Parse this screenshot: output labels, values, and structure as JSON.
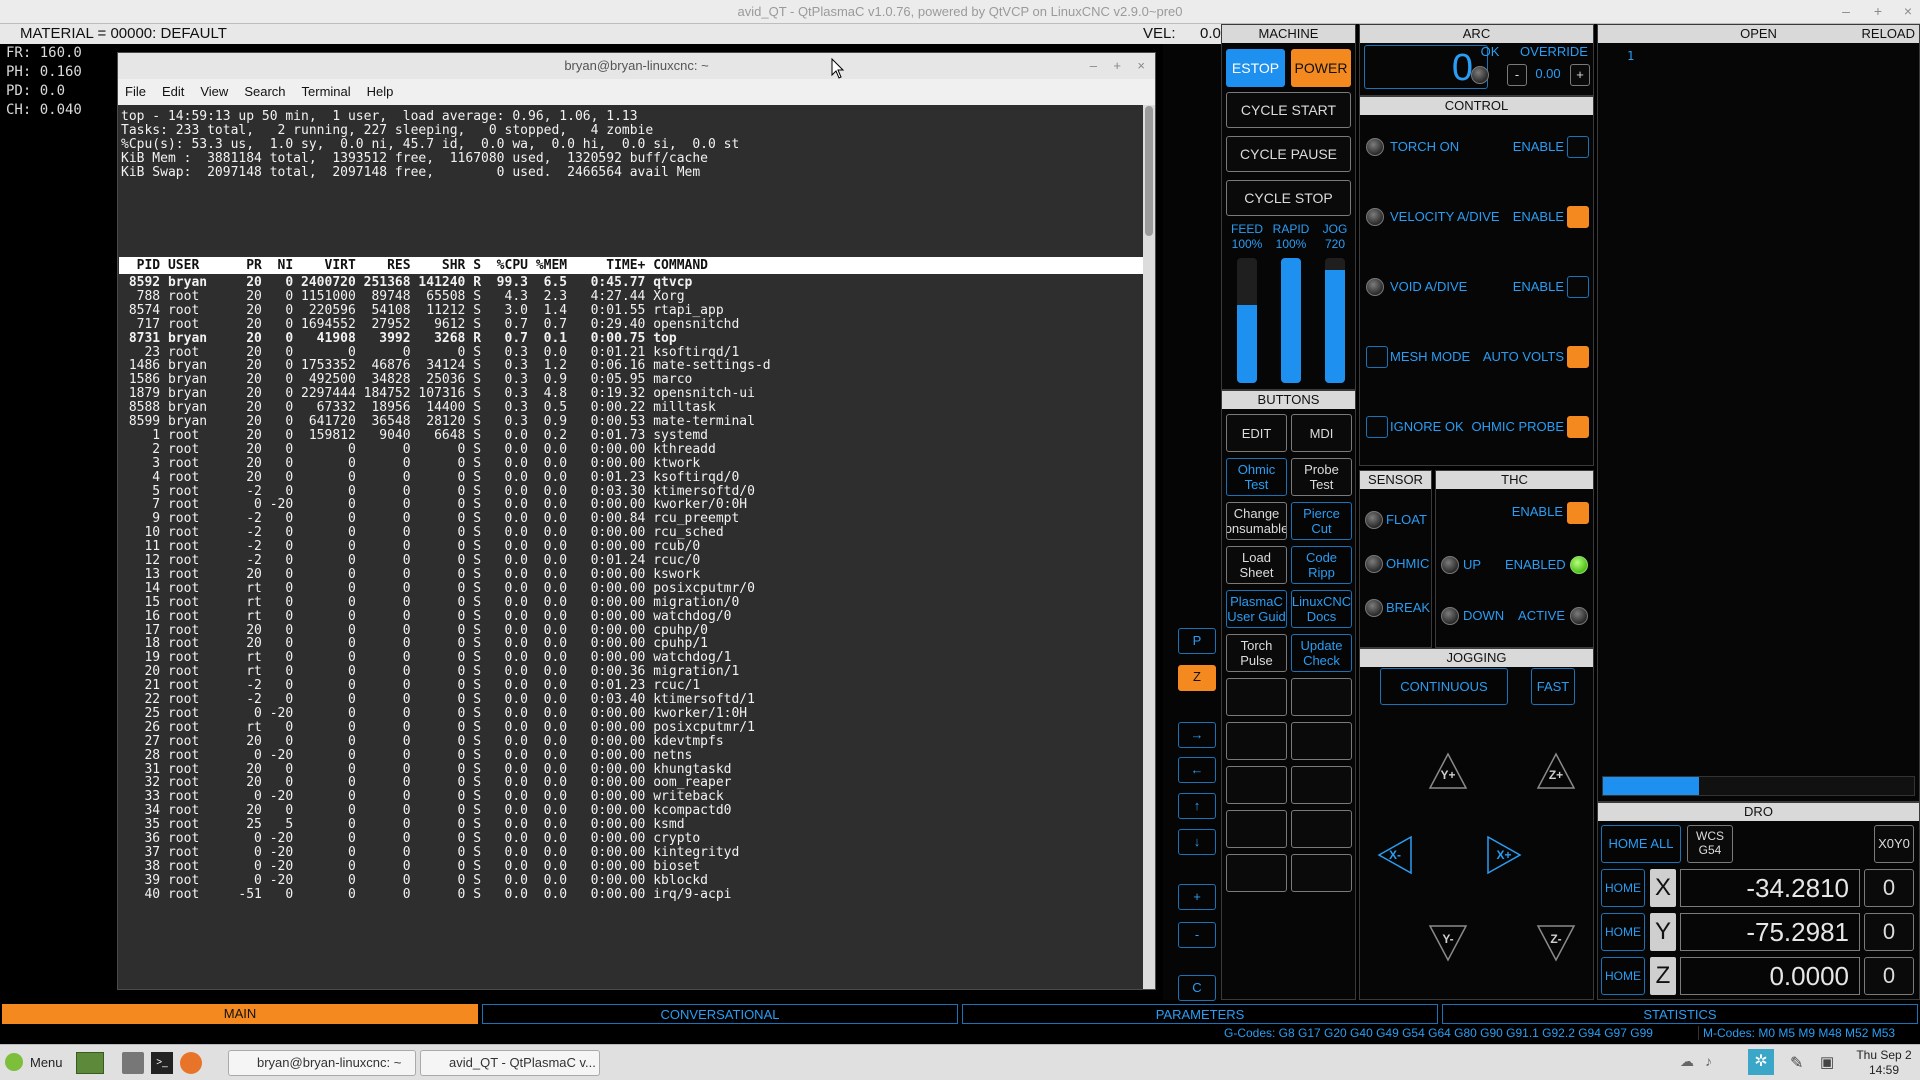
{
  "window": {
    "title": "avid_QT - QtPlasmaC v1.0.76, powered by QtVCP on LinuxCNC v2.9.0~pre0"
  },
  "infobar": {
    "material": "MATERIAL = 00000: DEFAULT",
    "vel_label": "VEL:",
    "vel_value": "0.0"
  },
  "overlay_stats": [
    "FR: 160.0",
    "PH: 0.160",
    "PD: 0.0",
    "CH: 0.040"
  ],
  "terminal": {
    "title": "bryan@bryan-linuxcnc: ~",
    "menu": [
      "File",
      "Edit",
      "View",
      "Search",
      "Terminal",
      "Help"
    ],
    "summary": [
      "top - 14:59:13 up 50 min,  1 user,  load average: 0.96, 1.06, 1.13",
      "Tasks: 233 total,   2 running, 227 sleeping,   0 stopped,   4 zombie",
      "%Cpu(s): 53.3 us,  1.0 sy,  0.0 ni, 45.7 id,  0.0 wa,  0.0 hi,  0.0 si,  0.0 st",
      "KiB Mem :  3881184 total,  1393512 free,  1167080 used,  1320592 buff/cache",
      "KiB Swap:  2097148 total,  2097148 free,        0 used.  2466564 avail Mem"
    ],
    "header": "  PID USER      PR  NI    VIRT    RES    SHR S  %CPU %MEM     TIME+ COMMAND",
    "rows": [
      " 8592 bryan     20   0 2400720 251368 141240 R  99.3  6.5   0:45.77 qtvcp",
      "  788 root      20   0 1151000  89748  65508 S   4.3  2.3   4:27.44 Xorg",
      " 8574 root      20   0  220596  54108  11212 S   3.0  1.4   0:01.55 rtapi_app",
      "  717 root      20   0 1694552  27952   9612 S   0.7  0.7   0:29.40 opensnitchd",
      " 8731 bryan     20   0   41908   3992   3268 R   0.7  0.1   0:00.75 top",
      "   23 root      20   0       0      0      0 S   0.3  0.0   0:01.21 ksoftirqd/1",
      " 1486 bryan     20   0 1753352  46876  34124 S   0.3  1.2   0:06.16 mate-settings-d",
      " 1586 bryan     20   0  492500  34828  25036 S   0.3  0.9   0:05.95 marco",
      " 1879 bryan     20   0 2297444 184752 107316 S   0.3  4.8   0:19.32 opensnitch-ui",
      " 8588 bryan     20   0   67332  18956  14400 S   0.3  0.5   0:00.22 milltask",
      " 8599 bryan     20   0  641720  36548  28120 S   0.3  0.9   0:00.53 mate-terminal",
      "    1 root      20   0  159812   9040   6648 S   0.0  0.2   0:01.73 systemd",
      "    2 root      20   0       0      0      0 S   0.0  0.0   0:00.00 kthreadd",
      "    3 root      20   0       0      0      0 S   0.0  0.0   0:00.00 ktwork",
      "    4 root      20   0       0      0      0 S   0.0  0.0   0:01.23 ksoftirqd/0",
      "    5 root      -2   0       0      0      0 S   0.0  0.0   0:03.30 ktimersoftd/0",
      "    7 root       0 -20       0      0      0 S   0.0  0.0   0:00.00 kworker/0:0H",
      "    9 root      -2   0       0      0      0 S   0.0  0.0   0:00.84 rcu_preempt",
      "   10 root      -2   0       0      0      0 S   0.0  0.0   0:00.00 rcu_sched",
      "   11 root      -2   0       0      0      0 S   0.0  0.0   0:00.00 rcub/0",
      "   12 root      -2   0       0      0      0 S   0.0  0.0   0:01.24 rcuc/0",
      "   13 root      20   0       0      0      0 S   0.0  0.0   0:00.00 kswork",
      "   14 root      rt   0       0      0      0 S   0.0  0.0   0:00.00 posixcputmr/0",
      "   15 root      rt   0       0      0      0 S   0.0  0.0   0:00.00 migration/0",
      "   16 root      rt   0       0      0      0 S   0.0  0.0   0:00.00 watchdog/0",
      "   17 root      20   0       0      0      0 S   0.0  0.0   0:00.00 cpuhp/0",
      "   18 root      20   0       0      0      0 S   0.0  0.0   0:00.00 cpuhp/1",
      "   19 root      rt   0       0      0      0 S   0.0  0.0   0:00.00 watchdog/1",
      "   20 root      rt   0       0      0      0 S   0.0  0.0   0:00.36 migration/1",
      "   21 root      -2   0       0      0      0 S   0.0  0.0   0:01.23 rcuc/1",
      "   22 root      -2   0       0      0      0 S   0.0  0.0   0:03.40 ktimersoftd/1",
      "   25 root       0 -20       0      0      0 S   0.0  0.0   0:00.00 kworker/1:0H",
      "   26 root      rt   0       0      0      0 S   0.0  0.0   0:00.00 posixcputmr/1",
      "   27 root      20   0       0      0      0 S   0.0  0.0   0:00.00 kdevtmpfs",
      "   28 root       0 -20       0      0      0 S   0.0  0.0   0:00.00 netns",
      "   31 root      20   0       0      0      0 S   0.0  0.0   0:00.00 khungtaskd",
      "   32 root      20   0       0      0      0 S   0.0  0.0   0:00.00 oom_reaper",
      "   33 root       0 -20       0      0      0 S   0.0  0.0   0:00.00 writeback",
      "   34 root      20   0       0      0      0 S   0.0  0.0   0:00.00 kcompactd0",
      "   35 root      25   5       0      0      0 S   0.0  0.0   0:00.00 ksmd",
      "   36 root       0 -20       0      0      0 S   0.0  0.0   0:00.00 crypto",
      "   37 root       0 -20       0      0      0 S   0.0  0.0   0:00.00 kintegrityd",
      "   38 root       0 -20       0      0      0 S   0.0  0.0   0:00.00 bioset",
      "   39 root       0 -20       0      0      0 S   0.0  0.0   0:00.00 kblockd",
      "   40 root     -51   0       0      0      0 S   0.0  0.0   0:00.00 irq/9-acpi"
    ],
    "bold_rows": [
      0,
      4
    ]
  },
  "side_strip": [
    "P",
    "Z",
    "→",
    "←",
    "↑",
    "↓",
    "+",
    "-",
    "C"
  ],
  "machine": {
    "title": "MACHINE",
    "estop": "ESTOP",
    "power": "POWER",
    "cycle_start": "CYCLE START",
    "cycle_pause": "CYCLE PAUSE",
    "cycle_stop": "CYCLE STOP",
    "sliders": [
      {
        "label": "FEED",
        "value": "100%",
        "level": 0.62
      },
      {
        "label": "RAPID",
        "value": "100%",
        "level": 1.0
      },
      {
        "label": "JOG",
        "value": "720",
        "level": 0.9
      }
    ]
  },
  "buttons": {
    "title": "BUTTONS",
    "items": [
      {
        "label": "EDIT",
        "style": "white"
      },
      {
        "label": "MDI",
        "style": "white"
      },
      {
        "label": "Ohmic Test",
        "style": "blue"
      },
      {
        "label": "Probe Test",
        "style": "white"
      },
      {
        "label": "Change onsumable",
        "style": "white"
      },
      {
        "label": "Pierce Cut",
        "style": "blue"
      },
      {
        "label": "Load Sheet",
        "style": "white"
      },
      {
        "label": "Code Ripp",
        "style": "blue"
      },
      {
        "label": "PlasmaC User Guid",
        "style": "blue"
      },
      {
        "label": "LinuxCNC Docs",
        "style": "blue"
      },
      {
        "label": "Torch Pulse",
        "style": "white"
      },
      {
        "label": "Update Check",
        "style": "blue"
      },
      {
        "label": "",
        "style": "white"
      },
      {
        "label": "",
        "style": "white"
      },
      {
        "label": "",
        "style": "white"
      },
      {
        "label": "",
        "style": "white"
      },
      {
        "label": "",
        "style": "white"
      },
      {
        "label": "",
        "style": "white"
      },
      {
        "label": "",
        "style": "white"
      },
      {
        "label": "",
        "style": "white"
      },
      {
        "label": "",
        "style": "white"
      },
      {
        "label": "",
        "style": "white"
      }
    ]
  },
  "arc": {
    "title": "ARC",
    "value": "0",
    "ok": "OK",
    "override": "OVERRIDE",
    "minus": "-",
    "override_value": "0.00",
    "plus": "+"
  },
  "control": {
    "title": "CONTROL",
    "rows": [
      {
        "left": "TORCH ON",
        "right": "ENABLE",
        "left_type": "led",
        "checked": false
      },
      {
        "left": "VELOCITY A/DIVE",
        "right": "ENABLE",
        "left_type": "led",
        "checked": true
      },
      {
        "left": "VOID A/DIVE",
        "right": "ENABLE",
        "left_type": "led",
        "checked": false
      },
      {
        "left": "MESH MODE",
        "right": "AUTO VOLTS",
        "left_type": "check",
        "checked": true
      },
      {
        "left": "IGNORE OK",
        "right": "OHMIC PROBE",
        "left_type": "check",
        "checked": true
      }
    ]
  },
  "sensor": {
    "title": "SENSOR",
    "items": [
      "FLOAT",
      "OHMIC",
      "BREAK"
    ]
  },
  "thc": {
    "title": "THC",
    "enable": "ENABLE",
    "up": "UP",
    "down": "DOWN",
    "enabled": "ENABLED",
    "active": "ACTIVE"
  },
  "jogging": {
    "title": "JOGGING",
    "continuous": "CONTINUOUS",
    "fast": "FAST",
    "yplus": "Y+",
    "zplus": "Z+",
    "xminus": "X-",
    "xplus": "X+",
    "yminus": "Y-",
    "zminus": "Z-"
  },
  "open": {
    "title": "OPEN",
    "reload": "RELOAD",
    "line1": "1",
    "progress": 0.31
  },
  "dro": {
    "title": "DRO",
    "home_all": "HOME ALL",
    "wcs": "WCS",
    "wcs_value": "G54",
    "x0y0": "X0Y0",
    "axes": [
      {
        "home": "HOME",
        "axis": "X",
        "value": "-34.2810",
        "zero": "0"
      },
      {
        "home": "HOME",
        "axis": "Y",
        "value": "-75.2981",
        "zero": "0"
      },
      {
        "home": "HOME",
        "axis": "Z",
        "value": "0.0000",
        "zero": "0"
      }
    ]
  },
  "tabs": [
    "MAIN",
    "CONVERSATIONAL",
    "PARAMETERS",
    "STATISTICS"
  ],
  "codes": {
    "gcodes": "G-Codes: G8 G17 G20 G40 G49 G54 G64 G80 G90 G91.1 G92.2 G94 G97 G99",
    "mcodes": "M-Codes: M0 M5 M9 M48 M52 M53"
  },
  "taskbar": {
    "menu": "Menu",
    "windows": [
      "bryan@bryan-linuxcnc: ~",
      "avid_QT - QtPlasmaC v..."
    ],
    "date": "Thu Sep 2",
    "time": "14:59"
  },
  "colors": {
    "accent": "#2a9df4",
    "orange": "#f48a1f",
    "panel_bg": "#060606"
  }
}
